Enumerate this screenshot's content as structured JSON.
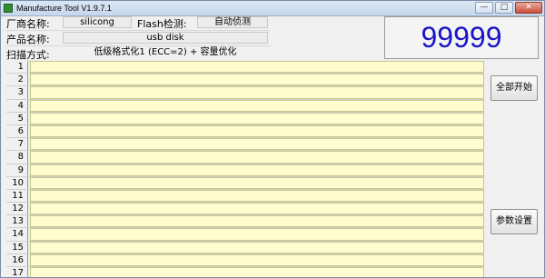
{
  "window": {
    "title": "Manufacture Tool  V1.9.7.1",
    "controls": [
      "minimize-icon",
      "maximize-icon",
      "close-icon"
    ]
  },
  "info": {
    "vendor_label": "厂商名称:",
    "vendor_value": "silicong",
    "flash_label": "Flash检测:",
    "flash_value": "自动侦测",
    "product_label": "产品名称:",
    "product_value": "usb disk",
    "scan_label": "扫描方式:",
    "scan_value": "低级格式化1 (ECC=2) + 容量优化"
  },
  "counter": "99999",
  "rows": [
    "1",
    "2",
    "3",
    "4",
    "5",
    "6",
    "7",
    "8",
    "9",
    "10",
    "11",
    "12",
    "13",
    "14",
    "15",
    "16",
    "17"
  ],
  "buttons": {
    "start_all": "全部开始",
    "settings": "参数设置"
  },
  "colors": {
    "counter_text": "#1a14c8",
    "row_fill": "#fffdd0"
  }
}
